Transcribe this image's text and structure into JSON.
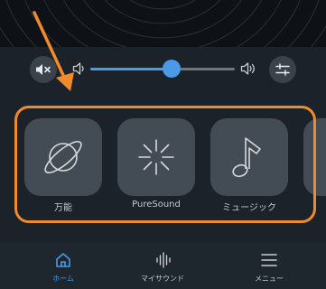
{
  "volume": {
    "level": 0.56
  },
  "modes": [
    {
      "label": "万能",
      "icon": "planet-icon"
    },
    {
      "label": "PureSound",
      "icon": "sparkle-icon"
    },
    {
      "label": "ミュージック",
      "icon": "music-note-icon"
    }
  ],
  "nav": {
    "items": [
      {
        "label": "ホーム",
        "icon": "home-icon",
        "active": true
      },
      {
        "label": "マイサウンド",
        "icon": "soundwave-icon",
        "active": false
      },
      {
        "label": "メニュー",
        "icon": "menu-icon",
        "active": false
      }
    ]
  },
  "colors": {
    "accent": "#4a9ae8",
    "annotation": "#f08a2a",
    "background": "#1b2229",
    "card": "#434b54"
  }
}
